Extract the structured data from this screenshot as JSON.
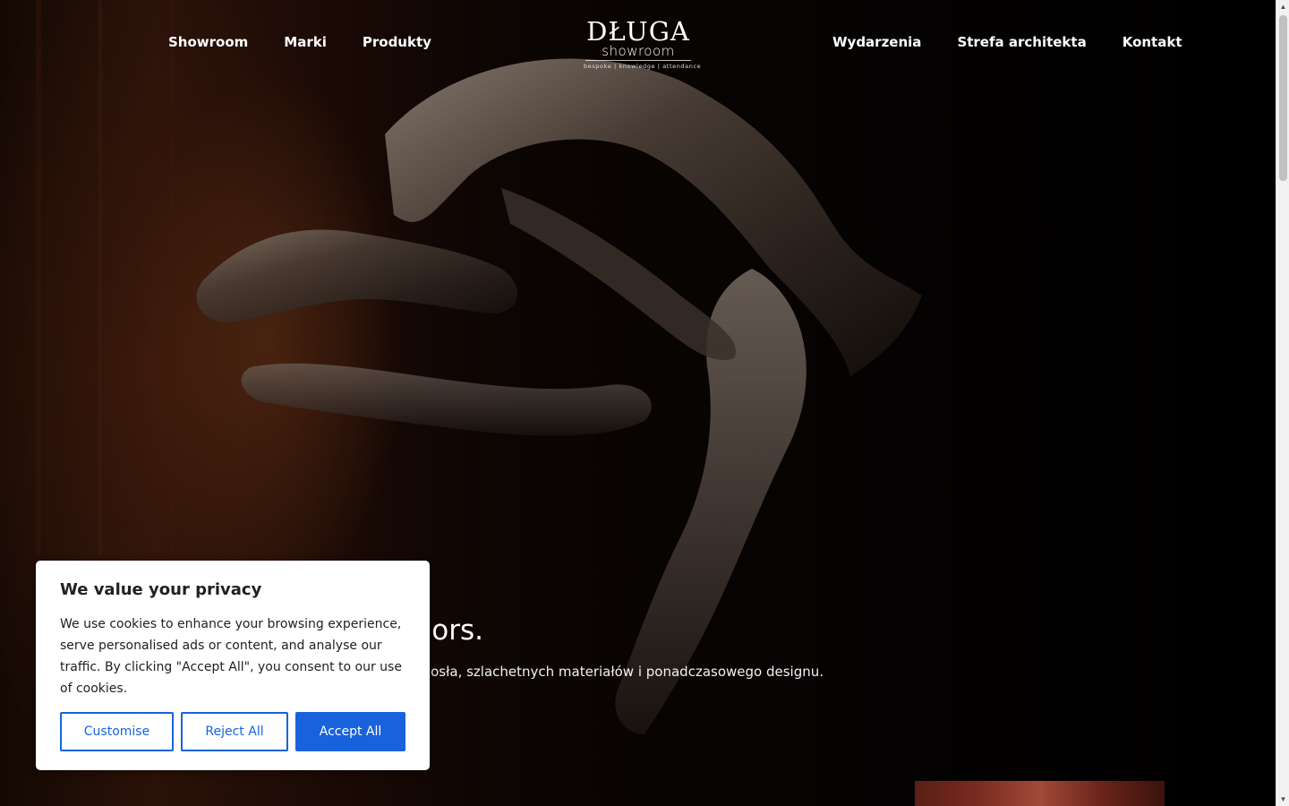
{
  "nav": {
    "left": [
      {
        "label": "Showroom"
      },
      {
        "label": "Marki"
      },
      {
        "label": "Produkty"
      }
    ],
    "right": [
      {
        "label": "Wydarzenia"
      },
      {
        "label": "Strefa architekta"
      },
      {
        "label": "Kontakt"
      }
    ]
  },
  "logo": {
    "main": "DŁUGA",
    "sub": "showroom",
    "tagline": "bespoke | knowledge | attendance"
  },
  "hero": {
    "title_visible": "ors.",
    "text_visible": "osła, szlachetnych materiałów i ponadczasowego designu."
  },
  "cookie": {
    "title": "We value your privacy",
    "text": "We use cookies to enhance your browsing experience, serve personalised ads or content, and analyse our traffic. By clicking \"Accept All\", you consent to our use of cookies.",
    "customise": "Customise",
    "reject": "Reject All",
    "accept": "Accept All"
  },
  "colors": {
    "accent": "#1863dc",
    "background": "#000000",
    "banner_bg": "#ffffff",
    "banner_text": "#212121"
  },
  "icons": {
    "scroll_up": "triangle-up-icon",
    "scroll_down": "triangle-down-icon"
  }
}
